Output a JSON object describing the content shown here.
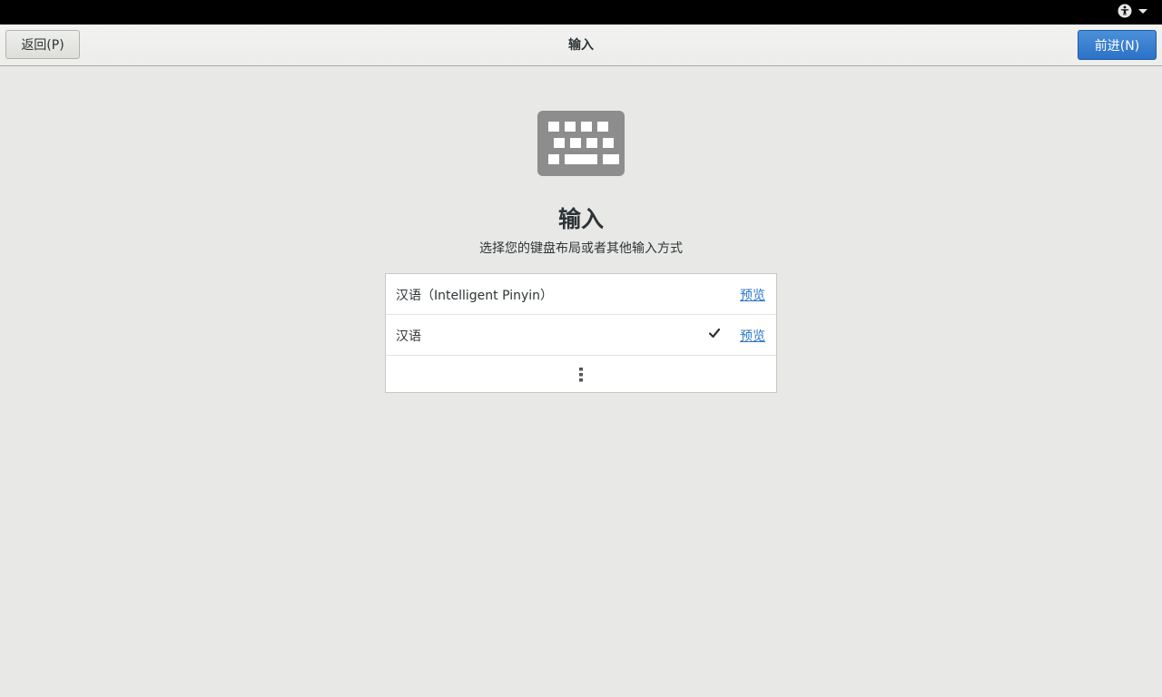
{
  "topbar": {
    "accessibility_icon": "accessibility-icon",
    "menu_icon": "chevron-down-icon"
  },
  "header": {
    "back_label": "返回(P)",
    "title": "输入",
    "next_label": "前进(N)"
  },
  "main": {
    "icon": "keyboard-icon",
    "title": "输入",
    "subtitle": "选择您的键盘布局或者其他输入方式",
    "sources": [
      {
        "label": "汉语（Intelligent Pinyin）",
        "selected": false,
        "preview_label": "预览"
      },
      {
        "label": "汉语",
        "selected": true,
        "preview_label": "预览"
      }
    ],
    "more_icon": "view-more-icon"
  },
  "colors": {
    "accent": "#3584e4",
    "link": "#2a76c6",
    "background": "#e8e8e7"
  }
}
